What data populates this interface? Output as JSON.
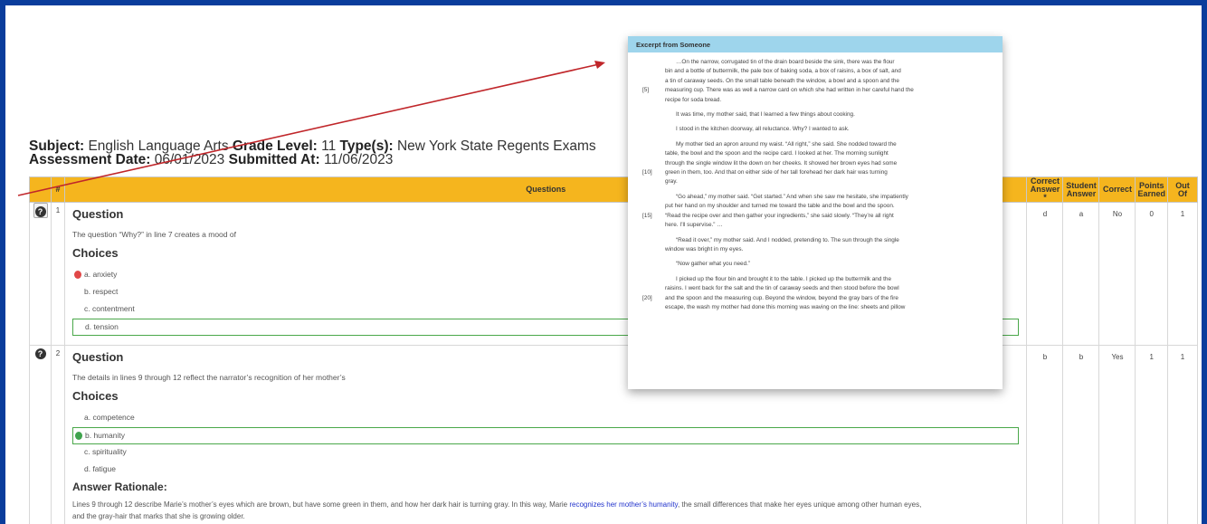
{
  "header": {
    "subject_label": "Subject:",
    "subject": "English Language Arts",
    "grade_label": "Grade Level:",
    "grade": "11",
    "type_label": "Type(s):",
    "type": "New York State Regents Exams",
    "date_label": "Assessment Date:",
    "date": "06/01/2023",
    "submitted_label": "Submitted At:",
    "submitted": "11/06/2023"
  },
  "table": {
    "col_num": "#",
    "col_questions": "Questions",
    "col_correct_answer_1": "Correct",
    "col_correct_answer_2": "Answer *",
    "col_student_answer_1": "Student",
    "col_student_answer_2": "Answer",
    "col_correct": "Correct",
    "col_points_1": "Points",
    "col_points_2": "Earned",
    "col_out_1": "Out",
    "col_out_2": "Of"
  },
  "icons": {
    "info": "question-circle-icon"
  },
  "questions": [
    {
      "num": "1",
      "title": "Question",
      "prompt": "The question “Why?” in line 7 creates a mood of",
      "choices_label": "Choices",
      "choices": [
        "a.  anxiety",
        "b.  respect",
        "c.  contentment",
        "d.  tension"
      ],
      "correct_answer": "d",
      "student_answer": "a",
      "correct": "No",
      "points": "0",
      "out_of": "1"
    },
    {
      "num": "2",
      "title": "Question",
      "prompt": "The details in lines 9 through 12 reflect the narrator’s recognition of her mother’s",
      "choices_label": "Choices",
      "choices": [
        "a.  competence",
        "b.  humanity",
        "c.  spirituality",
        "d.  fatigue"
      ],
      "rationale_label": "Answer Rationale:",
      "rationale_pre": "Lines 9 through 12 describe Marie’s mother’s eyes which are brown, but have some green in them, and how her dark hair is turning gray. In this way, Marie ",
      "rationale_highlight": "recognizes her mother’s humanity",
      "rationale_post": ", the small differences that make her eyes unique among other human eyes,",
      "rationale_line2": "and the gray-hair that marks that she is growing older.",
      "correct_answer": "b",
      "student_answer": "b",
      "correct": "Yes",
      "points": "1",
      "out_of": "1"
    }
  ],
  "excerpt": {
    "title": "Excerpt from Someone",
    "paragraphs": [
      {
        "line": "[5]",
        "lines": [
          "…On the narrow, corrugated tin of the drain board beside the sink, there was the flour",
          "bin and a bottle of buttermilk, the pale box of baking soda, a box of raisins, a box of salt, and",
          "a tin of caraway seeds. On the small table beneath the window, a bowl and a spoon and the",
          "measuring cup. There was as well a narrow card on which she had written in her careful hand the",
          "recipe for soda bread."
        ]
      },
      {
        "line": "",
        "lines": [
          "It was time, my mother said, that I learned a few things about cooking."
        ]
      },
      {
        "line": "",
        "lines": [
          "I stood in the kitchen doorway, all reluctance. Why? I wanted to ask."
        ]
      },
      {
        "line": "[10]",
        "lines": [
          "My mother tied an apron around my waist. “All right,” she said. She nodded toward the",
          "table, the bowl and the spoon and the recipe card. I looked at her. The morning sunlight",
          "through the single window lit the down on her cheeks. It showed her brown eyes had some",
          "green in them, too. And that on either side of her tall forehead her dark hair was turning",
          "gray."
        ]
      },
      {
        "line": "[15]",
        "lines": [
          "“Go ahead,” my mother said. “Get started.” And when she saw me hesitate, she impatiently",
          "put her hand on my shoulder and turned me toward the table and the bowl and the spoon.",
          "“Read the recipe over and then gather your ingredients,” she said slowly. “They’re all right",
          "here. I’ll supervise.” …"
        ]
      },
      {
        "line": "",
        "lines": [
          "“Read it over,” my mother said. And I nodded, pretending to. The sun through the single",
          "window was bright in my eyes."
        ]
      },
      {
        "line": "",
        "lines": [
          "“Now gather what you need.”"
        ]
      },
      {
        "line": "[20]",
        "lines": [
          "I picked up the flour bin and brought it to the table. I picked up the buttermilk and the",
          "raisins. I went back for the salt and the tin of caraway seeds and then stood before the bowl",
          "and the spoon and the measuring cup. Beyond the window, beyond the gray bars of the fire",
          "escape, the wash my mother had done this morning was waving on the line: sheets and pillow"
        ]
      }
    ]
  },
  "colors": {
    "frame_border": "#0a3d9c",
    "table_header": "#f5b51e",
    "excerpt_header": "#9ed5ec",
    "correct_outline": "#4aa84a",
    "wrong_marker": "#e14848",
    "arrow": "#c0262a"
  }
}
